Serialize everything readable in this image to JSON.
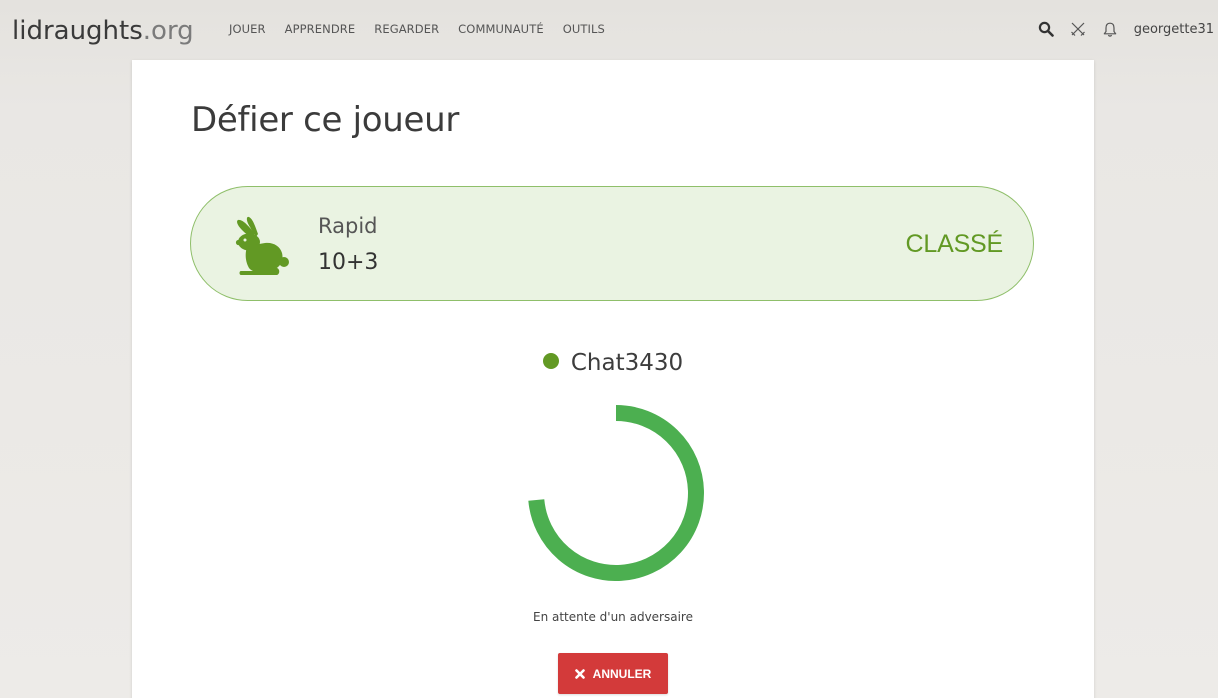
{
  "header": {
    "logo_main": "lidraughts",
    "logo_tld": ".org",
    "nav": [
      {
        "label": "JOUER"
      },
      {
        "label": "APPRENDRE"
      },
      {
        "label": "REGARDER"
      },
      {
        "label": "COMMUNAUTÉ"
      },
      {
        "label": "OUTILS"
      }
    ],
    "username": "georgette31"
  },
  "main": {
    "title": "Défier ce joueur",
    "mode": {
      "name": "Rapid",
      "time_control": "10+3",
      "rated_label": "CLASSÉ",
      "icon": "rabbit-icon"
    },
    "opponent": {
      "name": "Chat3430",
      "status": "online"
    },
    "waiting_text": "En attente d'un adversaire",
    "cancel_label": "ANNULER"
  },
  "colors": {
    "accent_green": "#629924",
    "spinner_green": "#4caf50",
    "mode_background": "#eaf3e2",
    "cancel_red": "#d33a3a"
  }
}
